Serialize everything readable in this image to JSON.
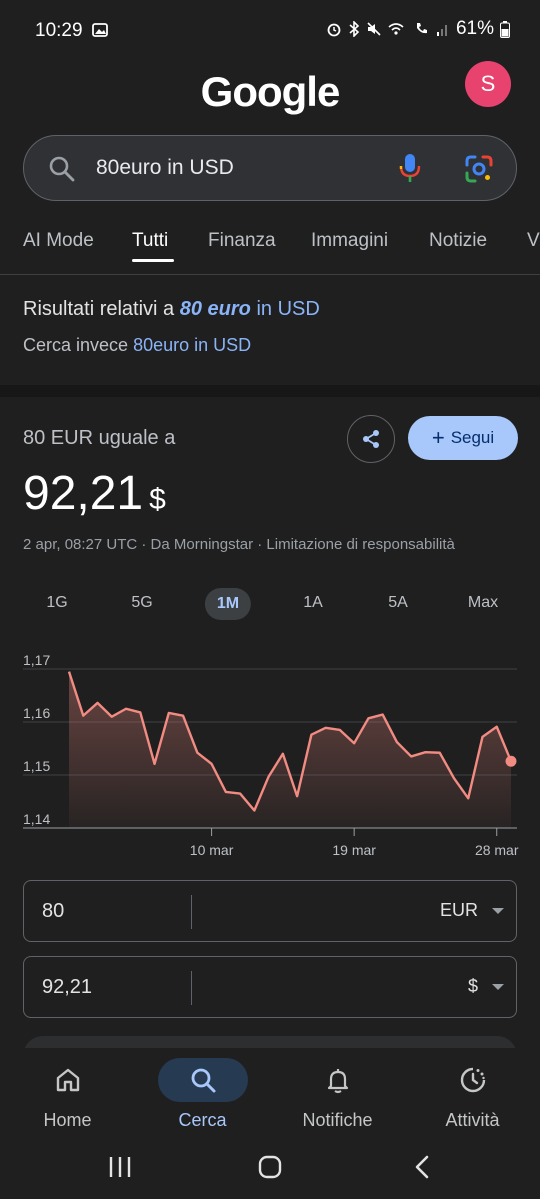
{
  "status_bar": {
    "time": "10:29",
    "battery": "61%"
  },
  "header": {
    "logo": "Google",
    "avatar_letter": "S"
  },
  "search": {
    "query": "80euro in USD"
  },
  "tabs": [
    "AI Mode",
    "Tutti",
    "Finanza",
    "Immagini",
    "Notizie",
    "V"
  ],
  "active_tab": "Tutti",
  "spelling": {
    "prefix": "Risultati relativi a",
    "corrected_term": "80 euro",
    "corrected_rest": "in USD",
    "instead_prefix": "Cerca invece",
    "instead_link": "80euro in USD"
  },
  "converter": {
    "equals_label": "80 EUR uguale a",
    "result_value": "92,21",
    "result_currency": "$",
    "source_line": "2 apr, 08:27 UTC · Da Morningstar · Limitazione di responsabilità",
    "follow_label": "Segui",
    "ranges": [
      "1G",
      "5G",
      "1M",
      "1A",
      "5A",
      "Max"
    ],
    "active_range": "1M",
    "from_value": "80",
    "from_unit": "EUR",
    "to_value": "92,21",
    "to_unit": "$"
  },
  "chart_data": {
    "type": "area",
    "y_ticks": [
      "1,17",
      "1,16",
      "1,15",
      "1,14"
    ],
    "ylim": [
      1.14,
      1.17
    ],
    "x_ticks": [
      {
        "label": "10 mar",
        "index": 10
      },
      {
        "label": "19 mar",
        "index": 20
      },
      {
        "label": "28 mar",
        "index": 30
      }
    ],
    "values": [
      1.1695,
      1.1612,
      1.1636,
      1.161,
      1.1625,
      1.1618,
      1.1521,
      1.1617,
      1.1612,
      1.1542,
      1.1521,
      1.1468,
      1.1465,
      1.1433,
      1.1497,
      1.154,
      1.146,
      1.1576,
      1.1589,
      1.1585,
      1.156,
      1.1607,
      1.1614,
      1.1562,
      1.1535,
      1.1543,
      1.1542,
      1.1494,
      1.1456,
      1.1572,
      1.1591,
      1.1526
    ],
    "line_color": "#f28b82",
    "grid": true
  },
  "bottom_nav": [
    {
      "label": "Home",
      "icon": "home-icon"
    },
    {
      "label": "Cerca",
      "icon": "search-icon"
    },
    {
      "label": "Notifiche",
      "icon": "bell-icon"
    },
    {
      "label": "Attività",
      "icon": "activity-icon"
    }
  ],
  "active_nav": "Cerca"
}
